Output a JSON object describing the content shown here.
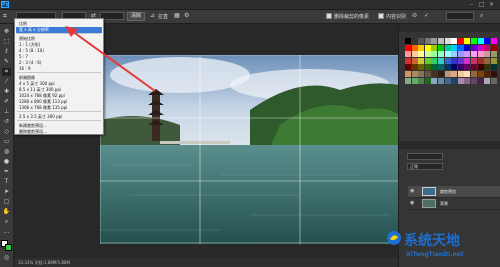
{
  "app": {
    "logo": "Ps"
  },
  "options": {
    "ratio_value": "比例",
    "swap_icon": "swap-icon",
    "clear_label": "清除",
    "straighten_label": "拉直",
    "delete_pixels_label": "删除裁剪的像素",
    "content_aware_label": "内容识别"
  },
  "ratio_menu": {
    "items": [
      {
        "label": "比例"
      },
      {
        "label": "宽 x 高 x 分辨率",
        "selected": true
      },
      {
        "label": "原始比例"
      },
      {
        "label": "1 : 1 (方形)"
      },
      {
        "label": "4 : 5 (8 : 10)"
      },
      {
        "label": "5 : 7"
      },
      {
        "label": "2 : 3 (4 : 6)"
      },
      {
        "label": "16 : 9"
      },
      {
        "label": "前端图像"
      },
      {
        "label": "4 x 5 英寸 300 ppi"
      },
      {
        "label": "8.5 x 11 英寸 300 ppi"
      },
      {
        "label": "1024 x 768 像素 92 ppi"
      },
      {
        "label": "1280 x 800 像素 113 ppi"
      },
      {
        "label": "1366 x 768 像素 135 ppi"
      },
      {
        "label": "2.5 x 3.5 英寸 300 ppi"
      },
      {
        "label": "新建裁剪预设..."
      },
      {
        "label": "删除裁剪预设..."
      }
    ]
  },
  "status": {
    "text": "33.33%   文档:1.88M/1.88M"
  },
  "layers": {
    "mode": "正常",
    "items": [
      {
        "name": "裁剪预览"
      },
      {
        "name": "背景"
      }
    ]
  },
  "watermark": {
    "text": "系统天地",
    "url": "XiTongTianDi.net"
  },
  "colors": {
    "accent": "#31a8ff",
    "selection": "#3b7ad8",
    "arrow": "#e53935",
    "foreground": "#ffffff",
    "background": "#2ecc40"
  }
}
